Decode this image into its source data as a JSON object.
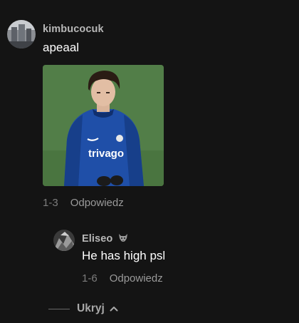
{
  "comment": {
    "username": "kimbucocuk",
    "text": "apeaal",
    "date": "1-3",
    "reply_label": "Odpowiedz",
    "attachment": {
      "jersey_text": "trivago",
      "colors": {
        "jersey": "#1f4fa8",
        "grass": "#4f7a44"
      }
    }
  },
  "reply": {
    "username": "Eliseo",
    "badge_icon": "wolf-emoji-icon",
    "text": "He has high psl",
    "date": "1-6",
    "reply_label": "Odpowiedz"
  },
  "thread_toggle": {
    "label": "Ukryj",
    "icon": "chevron-up-icon"
  },
  "colors": {
    "background": "#141414",
    "username": "#b8b8b8",
    "meta": "#8a8a8a"
  }
}
